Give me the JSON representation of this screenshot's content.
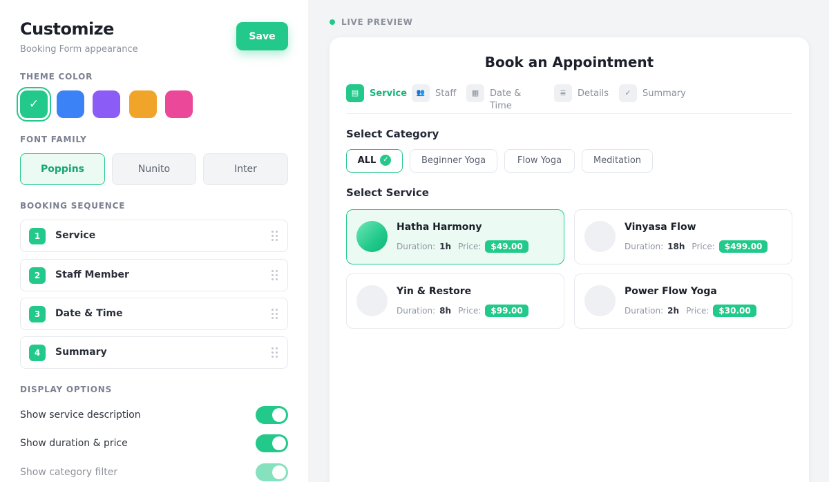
{
  "customize": {
    "title": "Customize",
    "subtitle": "Booking Form appearance",
    "save_label": "Save"
  },
  "theme": {
    "label": "THEME COLOR",
    "check": "✓",
    "colors": [
      "#22c98a",
      "#3b82f6",
      "#8b5cf6",
      "#f0a52a",
      "#ec4899"
    ],
    "selected_index": 0
  },
  "font": {
    "label": "FONT FAMILY",
    "options": [
      "Poppins",
      "Nunito",
      "Inter"
    ],
    "selected": "Poppins"
  },
  "sequence": {
    "label": "BOOKING SEQUENCE",
    "items": [
      {
        "num": "1",
        "label": "Service"
      },
      {
        "num": "2",
        "label": "Staff Member"
      },
      {
        "num": "3",
        "label": "Date & Time"
      },
      {
        "num": "4",
        "label": "Summary"
      }
    ]
  },
  "display": {
    "label": "DISPLAY OPTIONS",
    "options": [
      {
        "label": "Show service description",
        "on": true
      },
      {
        "label": "Show duration & price",
        "on": true
      },
      {
        "label": "Show category filter",
        "on": true
      }
    ]
  },
  "preview": {
    "live_label": "LIVE PREVIEW",
    "title": "Book an Appointment",
    "steps": [
      {
        "icon": "service-icon",
        "glyph": "▤",
        "label": "Service",
        "active": true
      },
      {
        "icon": "staff-icon",
        "glyph": "👥",
        "label": "Staff",
        "active": false
      },
      {
        "icon": "calendar-icon",
        "glyph": "▦",
        "label": "Date & Time",
        "label_line1": "Date &",
        "label_line2": "Time",
        "active": false
      },
      {
        "icon": "details-icon",
        "glyph": "≣",
        "label": "Details",
        "active": false
      },
      {
        "icon": "check-icon",
        "glyph": "✓",
        "label": "Summary",
        "active": false
      }
    ],
    "category_heading": "Select Category",
    "categories": [
      {
        "label": "ALL",
        "active": true
      },
      {
        "label": "Beginner Yoga",
        "active": false
      },
      {
        "label": "Flow Yoga",
        "active": false
      },
      {
        "label": "Meditation",
        "active": false
      }
    ],
    "service_heading": "Select Service",
    "duration_key": "Duration:",
    "price_key": "Price:",
    "services": [
      {
        "name": "Hatha Harmony",
        "duration": "1h",
        "price": "$49.00",
        "active": true
      },
      {
        "name": "Vinyasa Flow",
        "duration": "18h",
        "price": "$499.00",
        "active": false
      },
      {
        "name": "Yin & Restore",
        "duration": "8h",
        "price": "$99.00",
        "active": false
      },
      {
        "name": "Power Flow Yoga",
        "duration": "2h",
        "price": "$30.00",
        "active": false
      }
    ]
  }
}
